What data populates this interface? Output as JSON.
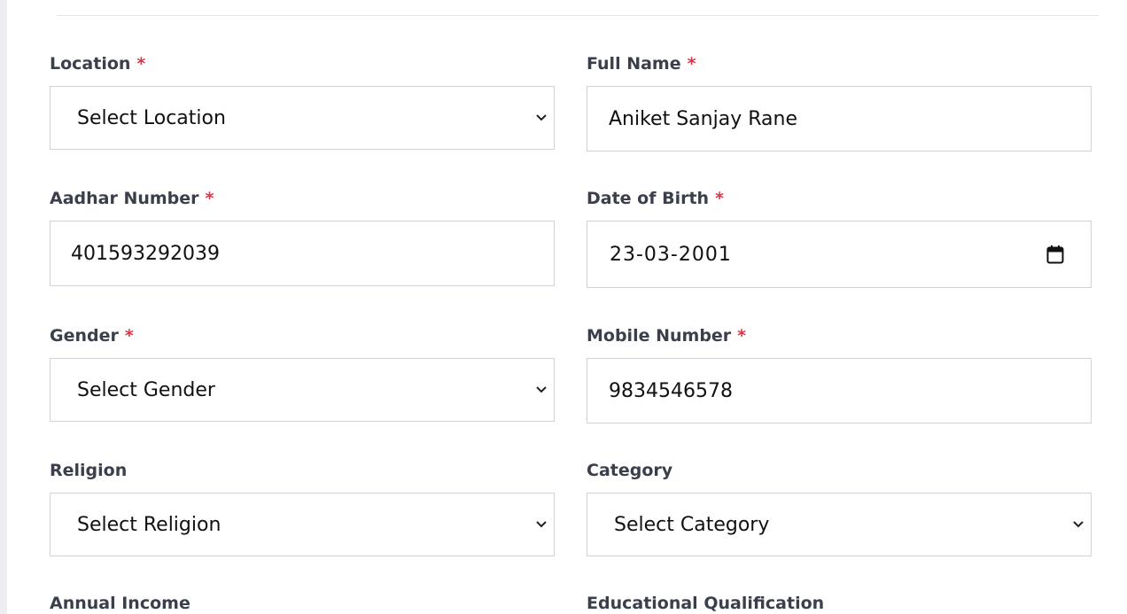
{
  "form": {
    "location": {
      "label": "Location",
      "required_mark": "*",
      "value": "Select Location"
    },
    "full_name": {
      "label": "Full Name",
      "required_mark": "*",
      "value": "Aniket Sanjay Rane"
    },
    "aadhar_number": {
      "label": "Aadhar Number",
      "required_mark": "*",
      "value": "401593292039"
    },
    "date_of_birth": {
      "label": "Date of Birth",
      "required_mark": "*",
      "value": "23-03-2001"
    },
    "gender": {
      "label": "Gender",
      "required_mark": "*",
      "value": "Select Gender"
    },
    "mobile_number": {
      "label": "Mobile Number",
      "required_mark": "*",
      "value": "9834546578"
    },
    "religion": {
      "label": "Religion",
      "value": "Select Religion"
    },
    "category": {
      "label": "Category",
      "value": "Select Category"
    },
    "annual_income": {
      "label": "Annual Income"
    },
    "educational_qualification": {
      "label": "Educational Qualification"
    }
  },
  "icons": {
    "select_arrow": "chevron-down-icon",
    "date_picker": "calendar-icon"
  },
  "colors": {
    "required": "#dc3545",
    "label": "#3a3f4b",
    "border": "#cfd3d9",
    "input_text": "#111111"
  }
}
